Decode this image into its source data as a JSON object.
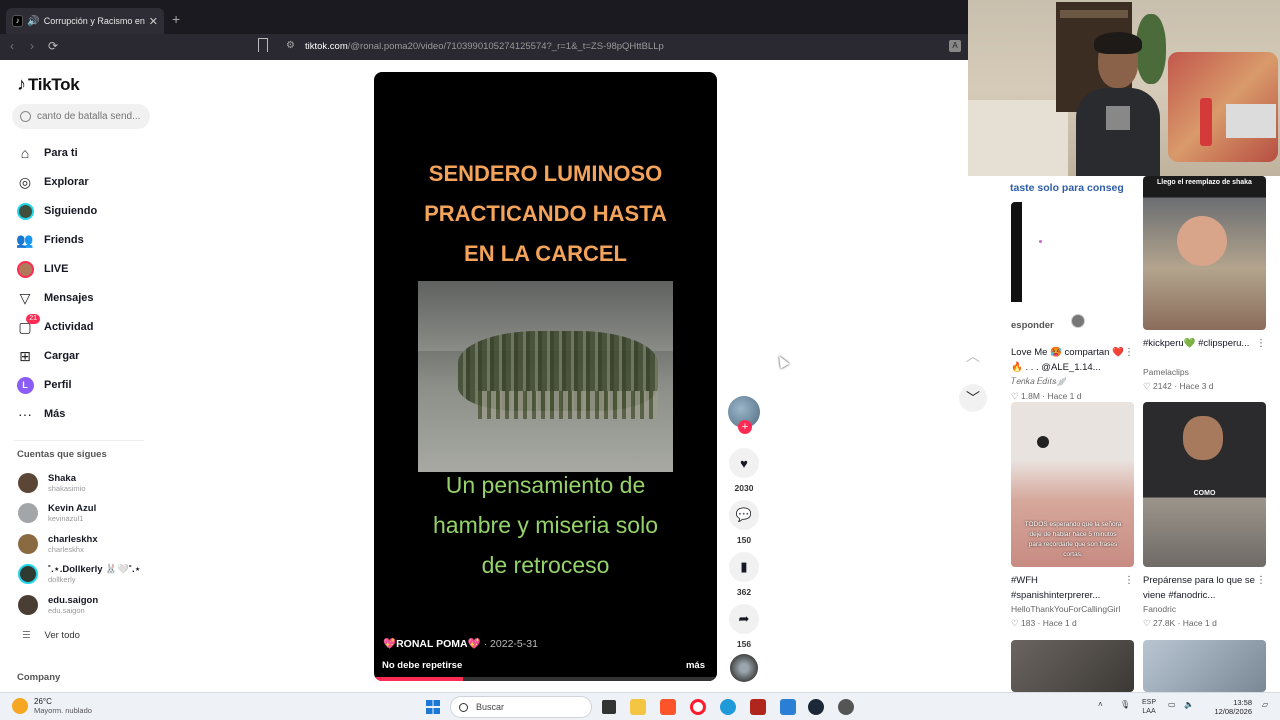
{
  "browser": {
    "tab_title": "Corrupción y Racismo en el P...",
    "tab_close": "✕",
    "new_tab": "+",
    "url_host": "tiktok.com",
    "url_path": "/@ronal.poma20/video/7103990105274125574?_r=1&_t=ZS-98pQHttBLLp"
  },
  "sidebar": {
    "logo": "TikTok",
    "search_placeholder": "canto de batalla send...",
    "nav": [
      {
        "label": "Para ti",
        "icon": "home-icon"
      },
      {
        "label": "Explorar",
        "icon": "compass-icon"
      },
      {
        "label": "Siguiendo",
        "icon": "avatar"
      },
      {
        "label": "Friends",
        "icon": "friends-icon"
      },
      {
        "label": "LIVE",
        "icon": "avatar"
      },
      {
        "label": "Mensajes",
        "icon": "send-icon"
      },
      {
        "label": "Actividad",
        "icon": "bell-icon",
        "badge": "21"
      },
      {
        "label": "Cargar",
        "icon": "plus-square-icon"
      },
      {
        "label": "Perfil",
        "icon": "avatar",
        "initial": "L"
      },
      {
        "label": "Más",
        "icon": "more-icon"
      }
    ],
    "following_title": "Cuentas que sigues",
    "following": [
      {
        "name": "Shaka",
        "handle": "shakasimio"
      },
      {
        "name": "Kevin Azul",
        "handle": "kevinazul1"
      },
      {
        "name": "charleskhx",
        "handle": "charleskhx"
      },
      {
        "name": "˚.⋆.Dollkerly 🐰🤍˚.⋆",
        "handle": "dollkerly"
      },
      {
        "name": "edu.saigon",
        "handle": "edu.saigon"
      }
    ],
    "see_all": "Ver todo",
    "company": "Company"
  },
  "video": {
    "title_lines": [
      "SENDERO LUMINOSO",
      "PRACTICANDO HASTA",
      "EN LA CARCEL"
    ],
    "subtitle_lines": [
      "Un pensamiento de",
      "hambre y miseria solo",
      "de retroceso"
    ],
    "author": "💖RONAL POMA💖",
    "date": "· 2022-5-31",
    "description": "No debe repetirse",
    "more": "más",
    "progress": 0.26,
    "colors": {
      "title": "#f4a35a",
      "subtitle": "#95d36a",
      "accent": "#fe2c55"
    }
  },
  "actions": {
    "likes": "2030",
    "comments": "150",
    "saves": "362",
    "shares": "156"
  },
  "right": {
    "header_text": "taste solo para conseg",
    "cards": [
      {
        "title": "Love Me 🥵 compartan ❤️🔥 . . . @ALE_1.14...",
        "author": "𝑇𝑒𝑛𝑘𝑎 𝐸𝑑𝑖𝑡𝑠🪽",
        "views": "1.8M",
        "time": "Hace 1 d",
        "extra": "esponder"
      },
      {
        "title": "#kickperu💚 #clipsperu...",
        "author": "Pamelaclips",
        "views": "2142",
        "time": "Hace 3 d",
        "thumb_text": "Llego el reemplazo de shaka"
      },
      {
        "title": "#WFH #spanishinterprerer...",
        "author": "HelloThankYouForCallingGirl",
        "views": "183",
        "time": "Hace 1 d",
        "thumb_text": "TODOS esperando que la señora deje de hablar hace 5 minutos para recordarle que son frases cortas."
      },
      {
        "title": "Prepárense para lo que se viene #fanodric...",
        "author": "Fanodric",
        "views": "27.8K",
        "time": "Hace 1 d",
        "thumb_text": "COMO"
      }
    ]
  },
  "taskbar": {
    "temp": "26°C",
    "weather": "Mayorm. nublado",
    "search": "Buscar",
    "lang": "ESP",
    "lang2": "LAA",
    "time": "13:58",
    "date": "12/08/2026"
  }
}
